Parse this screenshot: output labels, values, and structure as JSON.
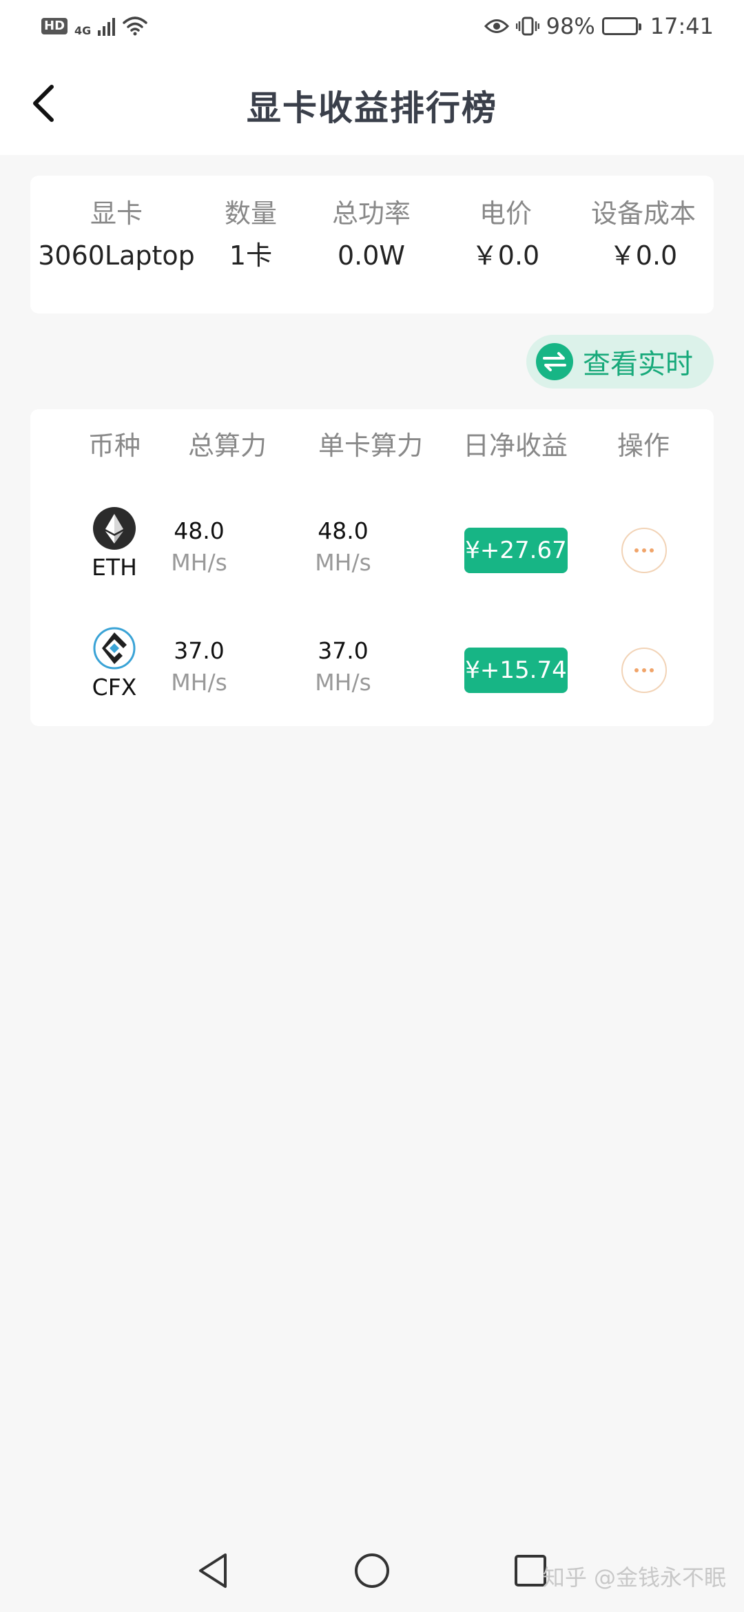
{
  "status_bar": {
    "hd": "HD",
    "network": "4G",
    "battery": "98%",
    "battery_level": 0.98,
    "time": "17:41"
  },
  "header": {
    "title": "显卡收益排行榜"
  },
  "summary": {
    "columns": [
      {
        "label": "显卡",
        "value": "3060Laptop"
      },
      {
        "label": "数量",
        "value": "1卡"
      },
      {
        "label": "总功率",
        "value": "0.0W"
      },
      {
        "label": "电价",
        "value": "￥0.0"
      },
      {
        "label": "设备成本",
        "value": "￥0.0"
      }
    ]
  },
  "realtime_button": {
    "label": "查看实时"
  },
  "table": {
    "headers": [
      "币种",
      "总算力",
      "单卡算力",
      "日净收益",
      "操作"
    ],
    "rows": [
      {
        "coin": "ETH",
        "total_hash": "48.0",
        "total_unit": "MH/s",
        "card_hash": "48.0",
        "card_unit": "MH/s",
        "profit": "¥+27.67"
      },
      {
        "coin": "CFX",
        "total_hash": "37.0",
        "total_unit": "MH/s",
        "card_hash": "37.0",
        "card_unit": "MH/s",
        "profit": "¥+15.74"
      }
    ]
  },
  "watermark": "知乎 @金钱永不眠",
  "colors": {
    "accent": "#17b585",
    "accent_light": "#dcf2ea",
    "more_border": "#f2d3b6",
    "more_dot": "#f0a46a"
  }
}
